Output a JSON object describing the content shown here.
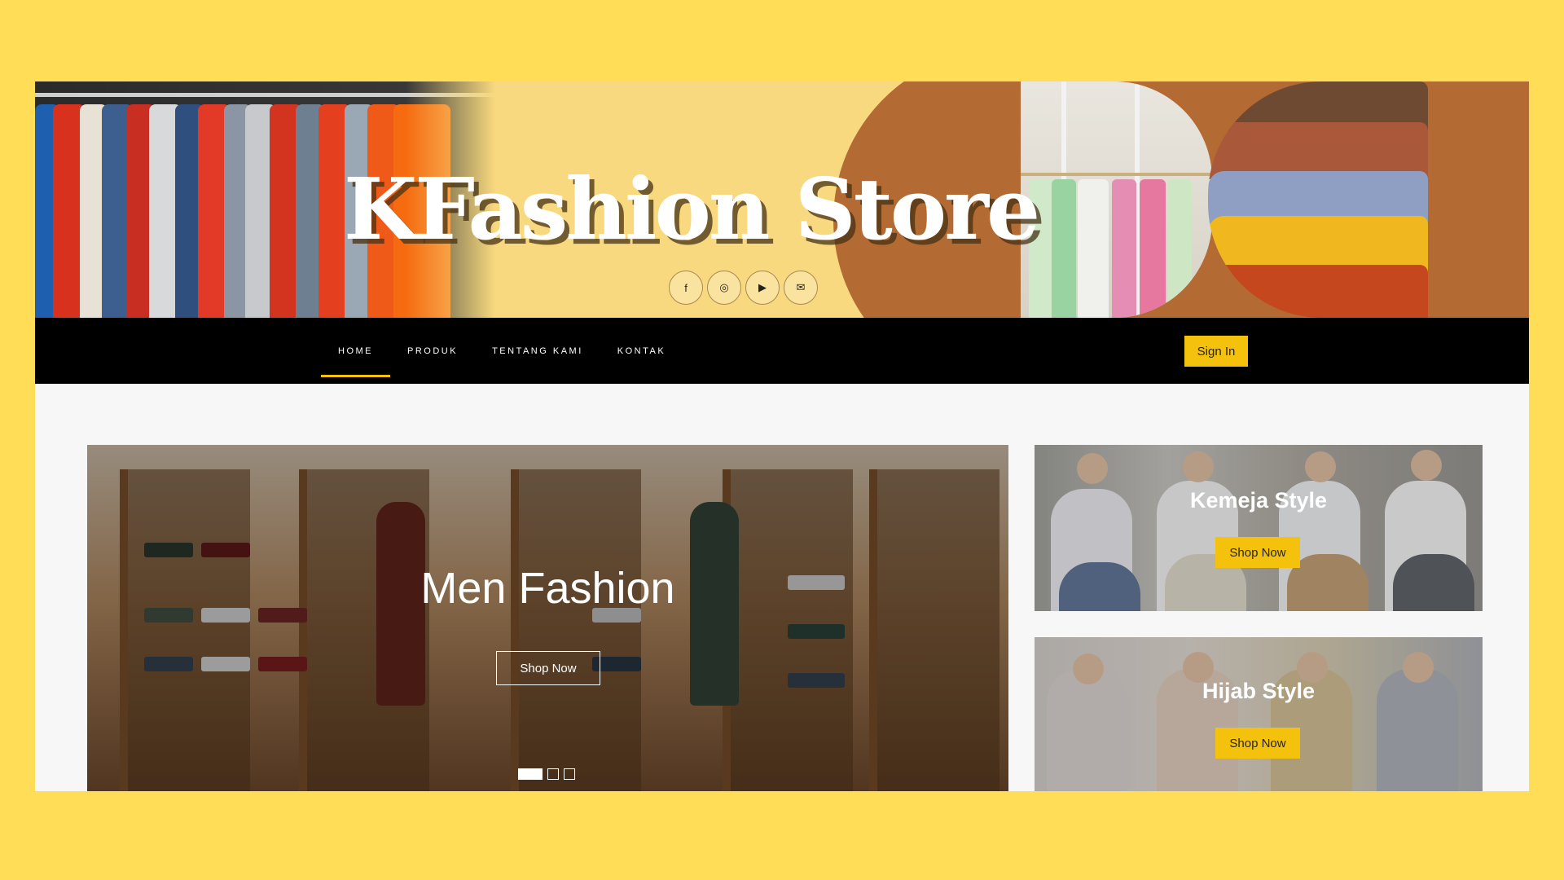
{
  "brand": {
    "title": "KFashion Store"
  },
  "social": [
    {
      "icon": "facebook-icon",
      "glyph": "f"
    },
    {
      "icon": "instagram-icon",
      "glyph": "◎"
    },
    {
      "icon": "youtube-icon",
      "glyph": "▶"
    },
    {
      "icon": "mail-icon",
      "glyph": "✉"
    }
  ],
  "nav": {
    "items": [
      {
        "label": "HOME",
        "active": true
      },
      {
        "label": "PRODUK",
        "active": false
      },
      {
        "label": "TENTANG KAMI",
        "active": false
      },
      {
        "label": "KONTAK",
        "active": false
      }
    ],
    "signin_label": "Sign In"
  },
  "hero": {
    "title": "Men Fashion",
    "button_label": "Shop Now",
    "slides": 3,
    "active_slide": 1
  },
  "cards": [
    {
      "title": "Kemeja Style",
      "button_label": "Shop Now"
    },
    {
      "title": "Hijab Style",
      "button_label": "Shop Now"
    }
  ],
  "colors": {
    "page_bg": "#FFDD57",
    "accent": "#F4C20D",
    "banner_bg": "#F8D97F",
    "banner_brown": "#B36A33",
    "nav_bg": "#000000"
  }
}
